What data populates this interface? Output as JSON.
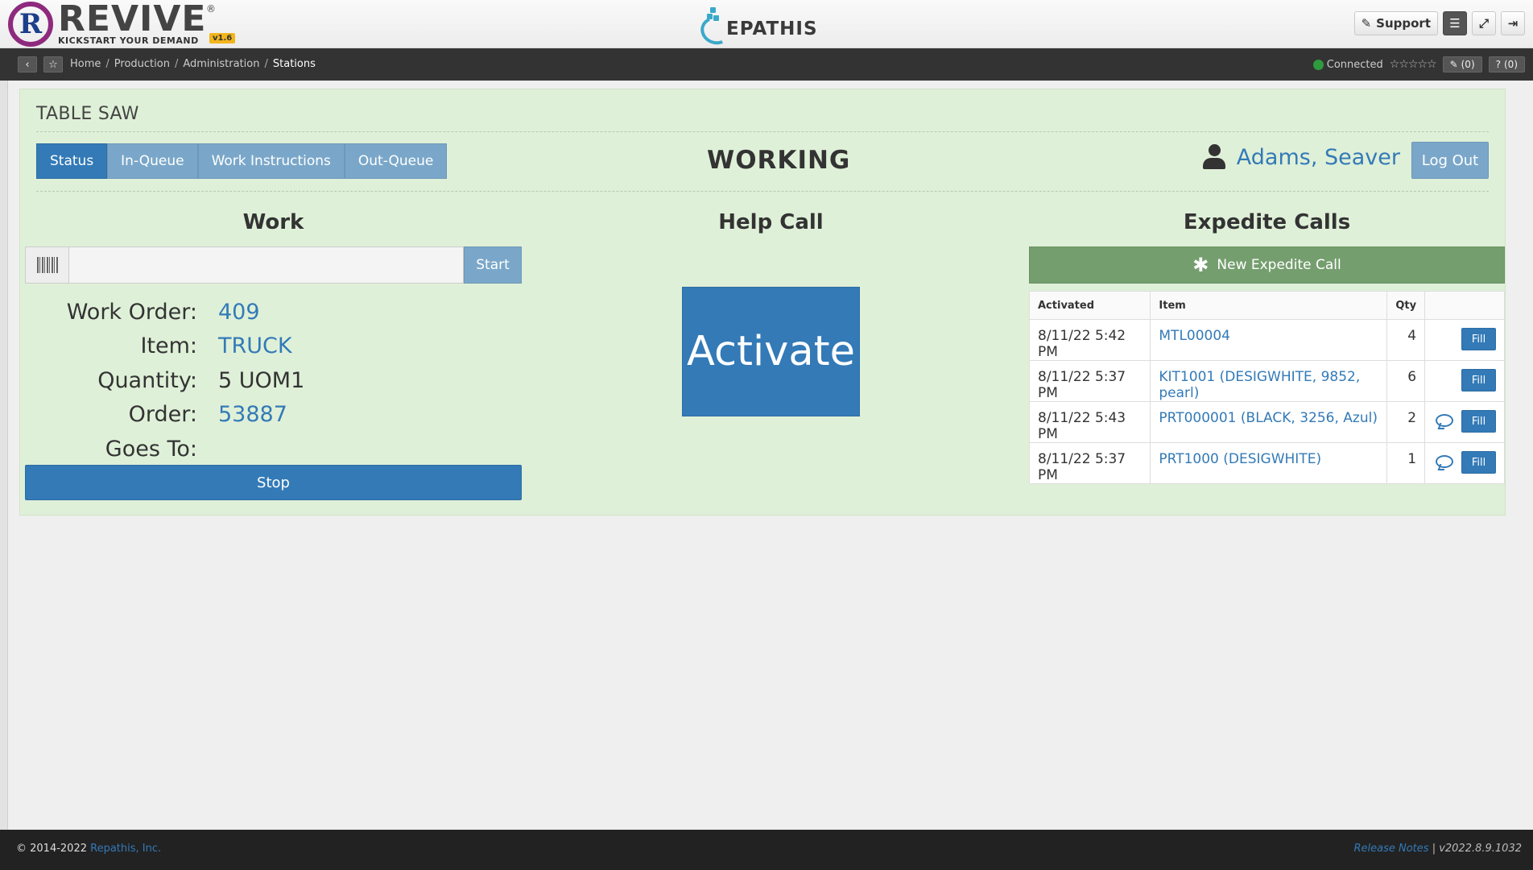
{
  "header": {
    "logo_word": "REVIVE",
    "logo_tagline": "KICKSTART YOUR DEMAND",
    "logo_version": "v1.6",
    "brand": "EPATHIS",
    "support_label": "Support"
  },
  "breadcrumb": {
    "items": [
      "Home",
      "Production",
      "Administration"
    ],
    "current": "Stations",
    "connection": "Connected",
    "stars": "☆☆☆☆☆",
    "attachments_count": "(0)",
    "help_count": "(0)"
  },
  "station": {
    "title": "TABLE SAW",
    "tabs": [
      "Status",
      "In-Queue",
      "Work Instructions",
      "Out-Queue"
    ],
    "active_tab": "Status",
    "status": "WORKING",
    "user": "Adams, Seaver",
    "logout_label": "Log Out"
  },
  "work": {
    "heading": "Work",
    "scan_value": "",
    "start_label": "Start",
    "fields": [
      {
        "label": "Work Order:",
        "value": "409"
      },
      {
        "label": "Item:",
        "value": "TRUCK"
      },
      {
        "label": "Quantity:",
        "value": "5 UOM1"
      },
      {
        "label": "Order:",
        "value": "53887"
      },
      {
        "label": "Goes To:",
        "value": ""
      }
    ],
    "stop_label": "Stop"
  },
  "help_call": {
    "heading": "Help Call",
    "activate_label": "Activate"
  },
  "expedite": {
    "heading": "Expedite Calls",
    "new_label": "New Expedite Call",
    "columns": [
      "Activated",
      "Item",
      "Qty",
      ""
    ],
    "fill_label": "Fill",
    "rows": [
      {
        "activated": "8/11/22 5:42 PM",
        "item": "MTL00004",
        "qty": "4",
        "comment": false
      },
      {
        "activated": "8/11/22 5:37 PM",
        "item": "KIT1001 (DESIGWHITE, 9852, pearl)",
        "qty": "6",
        "comment": false
      },
      {
        "activated": "8/11/22 5:43 PM",
        "item": "PRT000001 (BLACK, 3256, Azul)",
        "qty": "2",
        "comment": true
      },
      {
        "activated": "8/11/22 5:37 PM",
        "item": "PRT1000 (DESIGWHITE)",
        "qty": "1",
        "comment": true
      }
    ]
  },
  "footer": {
    "copyright": "© 2014-2022",
    "company": "Repathis, Inc.",
    "release_notes": "Release Notes",
    "version": "| v2022.8.9.1032"
  },
  "colors": {
    "primary": "#337ab7",
    "tab_inactive": "#7aa7c9",
    "panel_bg": "#dff0d8",
    "expedite_green": "#759e6f",
    "connected": "#2f9a3e"
  }
}
